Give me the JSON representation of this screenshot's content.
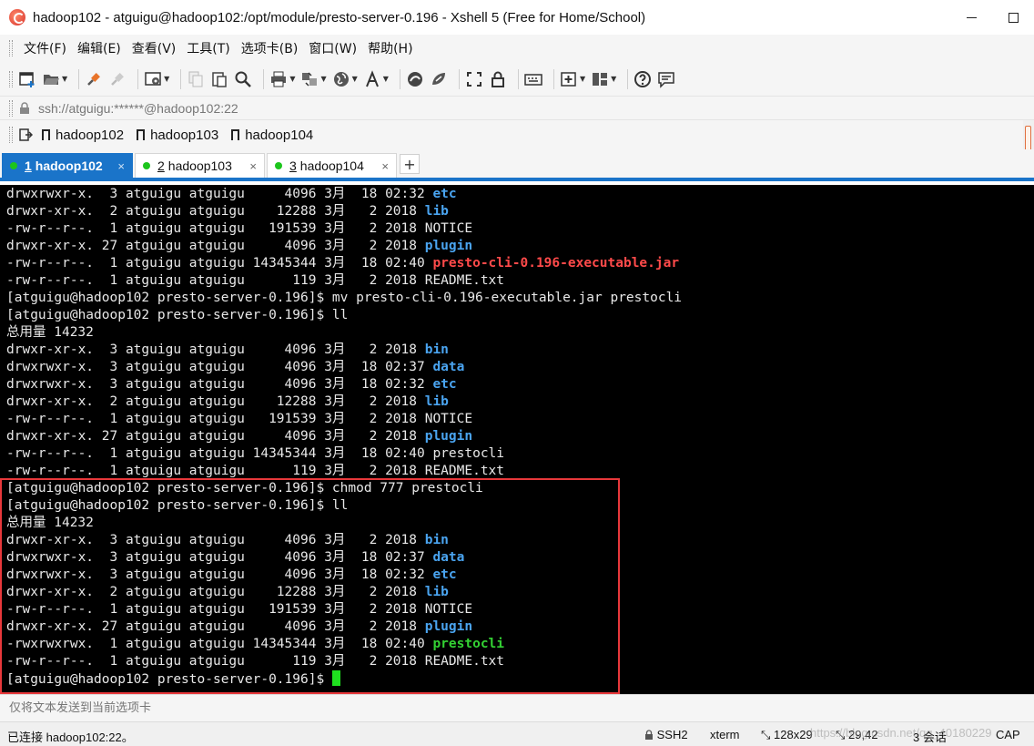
{
  "window": {
    "title": "hadoop102 - atguigu@hadoop102:/opt/module/presto-server-0.196 - Xshell 5 (Free for Home/School)"
  },
  "menu": [
    "文件(F)",
    "编辑(E)",
    "查看(V)",
    "工具(T)",
    "选项卡(B)",
    "窗口(W)",
    "帮助(H)"
  ],
  "address": {
    "value": "ssh://atguigu:******@hadoop102:22"
  },
  "links": [
    "hadoop102",
    "hadoop103",
    "hadoop104"
  ],
  "tabs": [
    {
      "num": "1",
      "label": "hadoop102",
      "active": true
    },
    {
      "num": "2",
      "label": "hadoop103",
      "active": false
    },
    {
      "num": "3",
      "label": "hadoop104",
      "active": false
    }
  ],
  "tab_close": "×",
  "tab_add": "+",
  "terminal": {
    "lines": [
      [
        {
          "t": "drwxrwxr-x.  3 atguigu atguigu     4096 3月  18 02:32 "
        },
        {
          "t": "etc",
          "c": "blue"
        }
      ],
      [
        {
          "t": "drwxr-xr-x.  2 atguigu atguigu    12288 3月   2 2018 "
        },
        {
          "t": "lib",
          "c": "blue"
        }
      ],
      [
        {
          "t": "-rw-r--r--.  1 atguigu atguigu   191539 3月   2 2018 NOTICE"
        }
      ],
      [
        {
          "t": "drwxr-xr-x. 27 atguigu atguigu     4096 3月   2 2018 "
        },
        {
          "t": "plugin",
          "c": "blue"
        }
      ],
      [
        {
          "t": "-rw-r--r--.  1 atguigu atguigu 14345344 3月  18 02:40 "
        },
        {
          "t": "presto-cli-0.196-executable.jar",
          "c": "red"
        }
      ],
      [
        {
          "t": "-rw-r--r--.  1 atguigu atguigu      119 3月   2 2018 README.txt"
        }
      ],
      [
        {
          "t": "[atguigu@hadoop102 presto-server-0.196]$ mv presto-cli-0.196-executable.jar prestocli"
        }
      ],
      [
        {
          "t": "[atguigu@hadoop102 presto-server-0.196]$ ll"
        }
      ],
      [
        {
          "t": "总用量 14232"
        }
      ],
      [
        {
          "t": "drwxr-xr-x.  3 atguigu atguigu     4096 3月   2 2018 "
        },
        {
          "t": "bin",
          "c": "blue"
        }
      ],
      [
        {
          "t": "drwxrwxr-x.  3 atguigu atguigu     4096 3月  18 02:37 "
        },
        {
          "t": "data",
          "c": "blue"
        }
      ],
      [
        {
          "t": "drwxrwxr-x.  3 atguigu atguigu     4096 3月  18 02:32 "
        },
        {
          "t": "etc",
          "c": "blue"
        }
      ],
      [
        {
          "t": "drwxr-xr-x.  2 atguigu atguigu    12288 3月   2 2018 "
        },
        {
          "t": "lib",
          "c": "blue"
        }
      ],
      [
        {
          "t": "-rw-r--r--.  1 atguigu atguigu   191539 3月   2 2018 NOTICE"
        }
      ],
      [
        {
          "t": "drwxr-xr-x. 27 atguigu atguigu     4096 3月   2 2018 "
        },
        {
          "t": "plugin",
          "c": "blue"
        }
      ],
      [
        {
          "t": "-rw-r--r--.  1 atguigu atguigu 14345344 3月  18 02:40 prestocli"
        }
      ],
      [
        {
          "t": "-rw-r--r--.  1 atguigu atguigu      119 3月   2 2018 README.txt"
        }
      ],
      [
        {
          "t": "[atguigu@hadoop102 presto-server-0.196]$ chmod 777 prestocli"
        }
      ],
      [
        {
          "t": "[atguigu@hadoop102 presto-server-0.196]$ ll"
        }
      ],
      [
        {
          "t": "总用量 14232"
        }
      ],
      [
        {
          "t": "drwxr-xr-x.  3 atguigu atguigu     4096 3月   2 2018 "
        },
        {
          "t": "bin",
          "c": "blue"
        }
      ],
      [
        {
          "t": "drwxrwxr-x.  3 atguigu atguigu     4096 3月  18 02:37 "
        },
        {
          "t": "data",
          "c": "blue"
        }
      ],
      [
        {
          "t": "drwxrwxr-x.  3 atguigu atguigu     4096 3月  18 02:32 "
        },
        {
          "t": "etc",
          "c": "blue"
        }
      ],
      [
        {
          "t": "drwxr-xr-x.  2 atguigu atguigu    12288 3月   2 2018 "
        },
        {
          "t": "lib",
          "c": "blue"
        }
      ],
      [
        {
          "t": "-rw-r--r--.  1 atguigu atguigu   191539 3月   2 2018 NOTICE"
        }
      ],
      [
        {
          "t": "drwxr-xr-x. 27 atguigu atguigu     4096 3月   2 2018 "
        },
        {
          "t": "plugin",
          "c": "blue"
        }
      ],
      [
        {
          "t": "-rwxrwxrwx.  1 atguigu atguigu 14345344 3月  18 02:40 "
        },
        {
          "t": "prestocli",
          "c": "green"
        }
      ],
      [
        {
          "t": "-rw-r--r--.  1 atguigu atguigu      119 3月   2 2018 README.txt"
        }
      ],
      [
        {
          "t": "[atguigu@hadoop102 presto-server-0.196]$ "
        },
        {
          "cursor": true
        }
      ]
    ]
  },
  "compose": {
    "placeholder": "仅将文本发送到当前选项卡"
  },
  "status": {
    "connection": "已连接 hadoop102:22。",
    "protocol": "SSH2",
    "terminal_type": "xterm",
    "size": "128x29",
    "position": "29,42",
    "sessions": "3 会话",
    "caps": "CAP",
    "watermark": "https://blog.csdn.net/qq_40180229"
  },
  "colors": {
    "accent": "#1a74c9",
    "highlight_box": "#e8383b",
    "term_blue": "#4aa4f0",
    "term_red": "#ff4a4a",
    "term_green": "#33d133"
  }
}
